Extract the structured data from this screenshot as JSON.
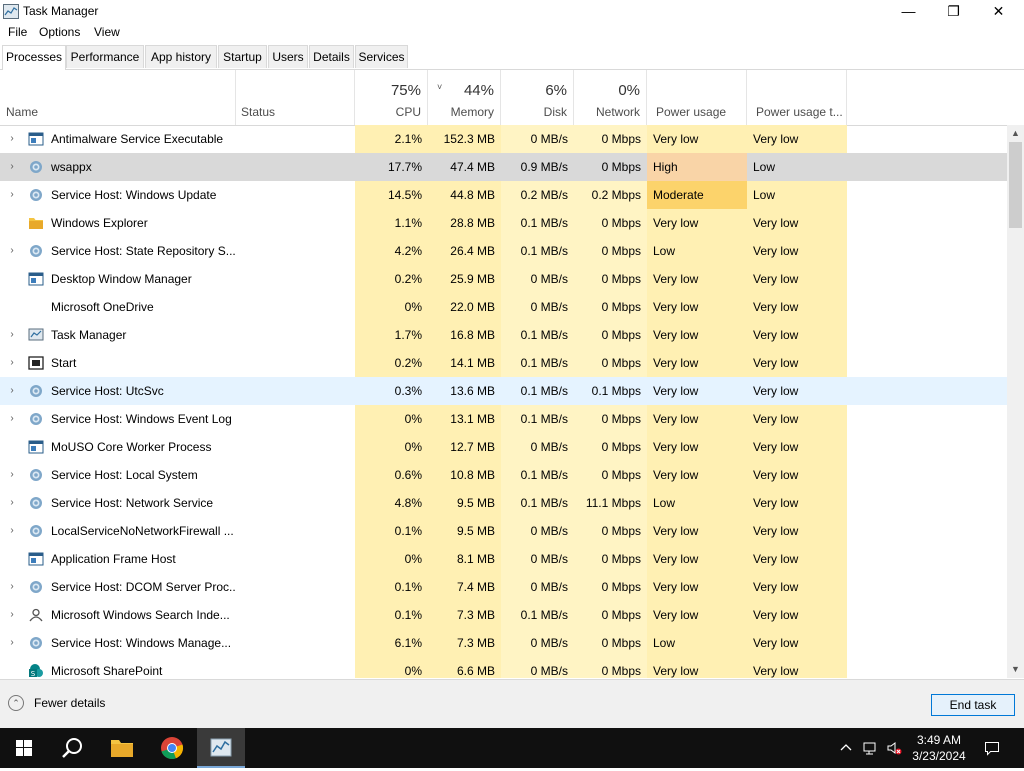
{
  "window": {
    "title": "Task Manager",
    "controls": {
      "minimize": "—",
      "maximize": "❐",
      "close": "✕"
    }
  },
  "menu": [
    "File",
    "Options",
    "View"
  ],
  "tabs": [
    "Processes",
    "Performance",
    "App history",
    "Startup",
    "Users",
    "Details",
    "Services"
  ],
  "active_tab": "Processes",
  "columns": {
    "name": "Name",
    "status": "Status",
    "cpu": {
      "pct": "75%",
      "label": "CPU"
    },
    "memory": {
      "pct": "44%",
      "label": "Memory",
      "sort": "˅"
    },
    "disk": {
      "pct": "6%",
      "label": "Disk"
    },
    "network": {
      "pct": "0%",
      "label": "Network"
    },
    "power": "Power usage",
    "power_trend": "Power usage t..."
  },
  "rows": [
    {
      "expand": "›",
      "icon": "window-icon",
      "name": "Antimalware Service Executable",
      "cpu": "2.1%",
      "mem": "152.3 MB",
      "disk": "0 MB/s",
      "net": "0 Mbps",
      "power": "Very low",
      "power_trend": "Very low"
    },
    {
      "expand": "›",
      "icon": "gear-icon",
      "name": "wsappx",
      "cpu": "17.7%",
      "mem": "47.4 MB",
      "disk": "0.9 MB/s",
      "net": "0 Mbps",
      "power": "High",
      "power_trend": "Low"
    },
    {
      "expand": "›",
      "icon": "gear-icon",
      "name": "Service Host: Windows Update",
      "cpu": "14.5%",
      "mem": "44.8 MB",
      "disk": "0.2 MB/s",
      "net": "0.2 Mbps",
      "power": "Moderate",
      "power_trend": "Low"
    },
    {
      "expand": "",
      "icon": "folder-icon",
      "name": "Windows Explorer",
      "cpu": "1.1%",
      "mem": "28.8 MB",
      "disk": "0.1 MB/s",
      "net": "0 Mbps",
      "power": "Very low",
      "power_trend": "Very low"
    },
    {
      "expand": "›",
      "icon": "gear-icon",
      "name": "Service Host: State Repository S...",
      "cpu": "4.2%",
      "mem": "26.4 MB",
      "disk": "0.1 MB/s",
      "net": "0 Mbps",
      "power": "Low",
      "power_trend": "Very low"
    },
    {
      "expand": "",
      "icon": "window-icon",
      "name": "Desktop Window Manager",
      "cpu": "0.2%",
      "mem": "25.9 MB",
      "disk": "0 MB/s",
      "net": "0 Mbps",
      "power": "Very low",
      "power_trend": "Very low"
    },
    {
      "expand": "",
      "icon": "",
      "name": "Microsoft OneDrive",
      "cpu": "0%",
      "mem": "22.0 MB",
      "disk": "0 MB/s",
      "net": "0 Mbps",
      "power": "Very low",
      "power_trend": "Very low"
    },
    {
      "expand": "›",
      "icon": "taskmgr-icon",
      "name": "Task Manager",
      "cpu": "1.7%",
      "mem": "16.8 MB",
      "disk": "0.1 MB/s",
      "net": "0 Mbps",
      "power": "Very low",
      "power_trend": "Very low"
    },
    {
      "expand": "›",
      "icon": "start-icon",
      "name": "Start",
      "cpu": "0.2%",
      "mem": "14.1 MB",
      "disk": "0.1 MB/s",
      "net": "0 Mbps",
      "power": "Very low",
      "power_trend": "Very low"
    },
    {
      "expand": "›",
      "icon": "gear-icon",
      "name": "Service Host: UtcSvc",
      "cpu": "0.3%",
      "mem": "13.6 MB",
      "disk": "0.1 MB/s",
      "net": "0.1 Mbps",
      "power": "Very low",
      "power_trend": "Very low"
    },
    {
      "expand": "›",
      "icon": "gear-icon",
      "name": "Service Host: Windows Event Log",
      "cpu": "0%",
      "mem": "13.1 MB",
      "disk": "0.1 MB/s",
      "net": "0 Mbps",
      "power": "Very low",
      "power_trend": "Very low"
    },
    {
      "expand": "",
      "icon": "window-icon",
      "name": "MoUSO Core Worker Process",
      "cpu": "0%",
      "mem": "12.7 MB",
      "disk": "0 MB/s",
      "net": "0 Mbps",
      "power": "Very low",
      "power_trend": "Very low"
    },
    {
      "expand": "›",
      "icon": "gear-icon",
      "name": "Service Host: Local System",
      "cpu": "0.6%",
      "mem": "10.8 MB",
      "disk": "0.1 MB/s",
      "net": "0 Mbps",
      "power": "Very low",
      "power_trend": "Very low"
    },
    {
      "expand": "›",
      "icon": "gear-icon",
      "name": "Service Host: Network Service",
      "cpu": "4.8%",
      "mem": "9.5 MB",
      "disk": "0.1 MB/s",
      "net": "11.1 Mbps",
      "power": "Low",
      "power_trend": "Very low"
    },
    {
      "expand": "›",
      "icon": "gear-icon",
      "name": "LocalServiceNoNetworkFirewall ...",
      "cpu": "0.1%",
      "mem": "9.5 MB",
      "disk": "0 MB/s",
      "net": "0 Mbps",
      "power": "Very low",
      "power_trend": "Very low"
    },
    {
      "expand": "",
      "icon": "window-icon",
      "name": "Application Frame Host",
      "cpu": "0%",
      "mem": "8.1 MB",
      "disk": "0 MB/s",
      "net": "0 Mbps",
      "power": "Very low",
      "power_trend": "Very low"
    },
    {
      "expand": "›",
      "icon": "gear-icon",
      "name": "Service Host: DCOM Server Proc...",
      "cpu": "0.1%",
      "mem": "7.4 MB",
      "disk": "0 MB/s",
      "net": "0 Mbps",
      "power": "Very low",
      "power_trend": "Very low"
    },
    {
      "expand": "›",
      "icon": "search-user-icon",
      "name": "Microsoft Windows Search Inde...",
      "cpu": "0.1%",
      "mem": "7.3 MB",
      "disk": "0.1 MB/s",
      "net": "0 Mbps",
      "power": "Very low",
      "power_trend": "Very low"
    },
    {
      "expand": "›",
      "icon": "gear-icon",
      "name": "Service Host: Windows Manage...",
      "cpu": "6.1%",
      "mem": "7.3 MB",
      "disk": "0 MB/s",
      "net": "0 Mbps",
      "power": "Low",
      "power_trend": "Very low"
    },
    {
      "expand": "",
      "icon": "sharepoint-icon",
      "name": "Microsoft SharePoint",
      "cpu": "0%",
      "mem": "6.6 MB",
      "disk": "0 MB/s",
      "net": "0 Mbps",
      "power": "Very low",
      "power_trend": "Very low"
    }
  ],
  "selected_row": 1,
  "hover_row": 9,
  "colors": {
    "heat_light": "#fff4c4",
    "heat_medium": "#fff0b3",
    "power_high": "#f9d4a7",
    "power_moderate": "#fcd36b",
    "selected": "#d9d9d9",
    "hover": "#e5f3ff"
  },
  "footer": {
    "fewer_details": "Fewer details",
    "end_task": "End task"
  },
  "taskbar": {
    "time": "3:49 AM",
    "date": "3/23/2024",
    "apps": [
      "windows-start-icon",
      "search-icon",
      "file-explorer-icon",
      "chrome-icon",
      "task-manager-icon"
    ]
  }
}
